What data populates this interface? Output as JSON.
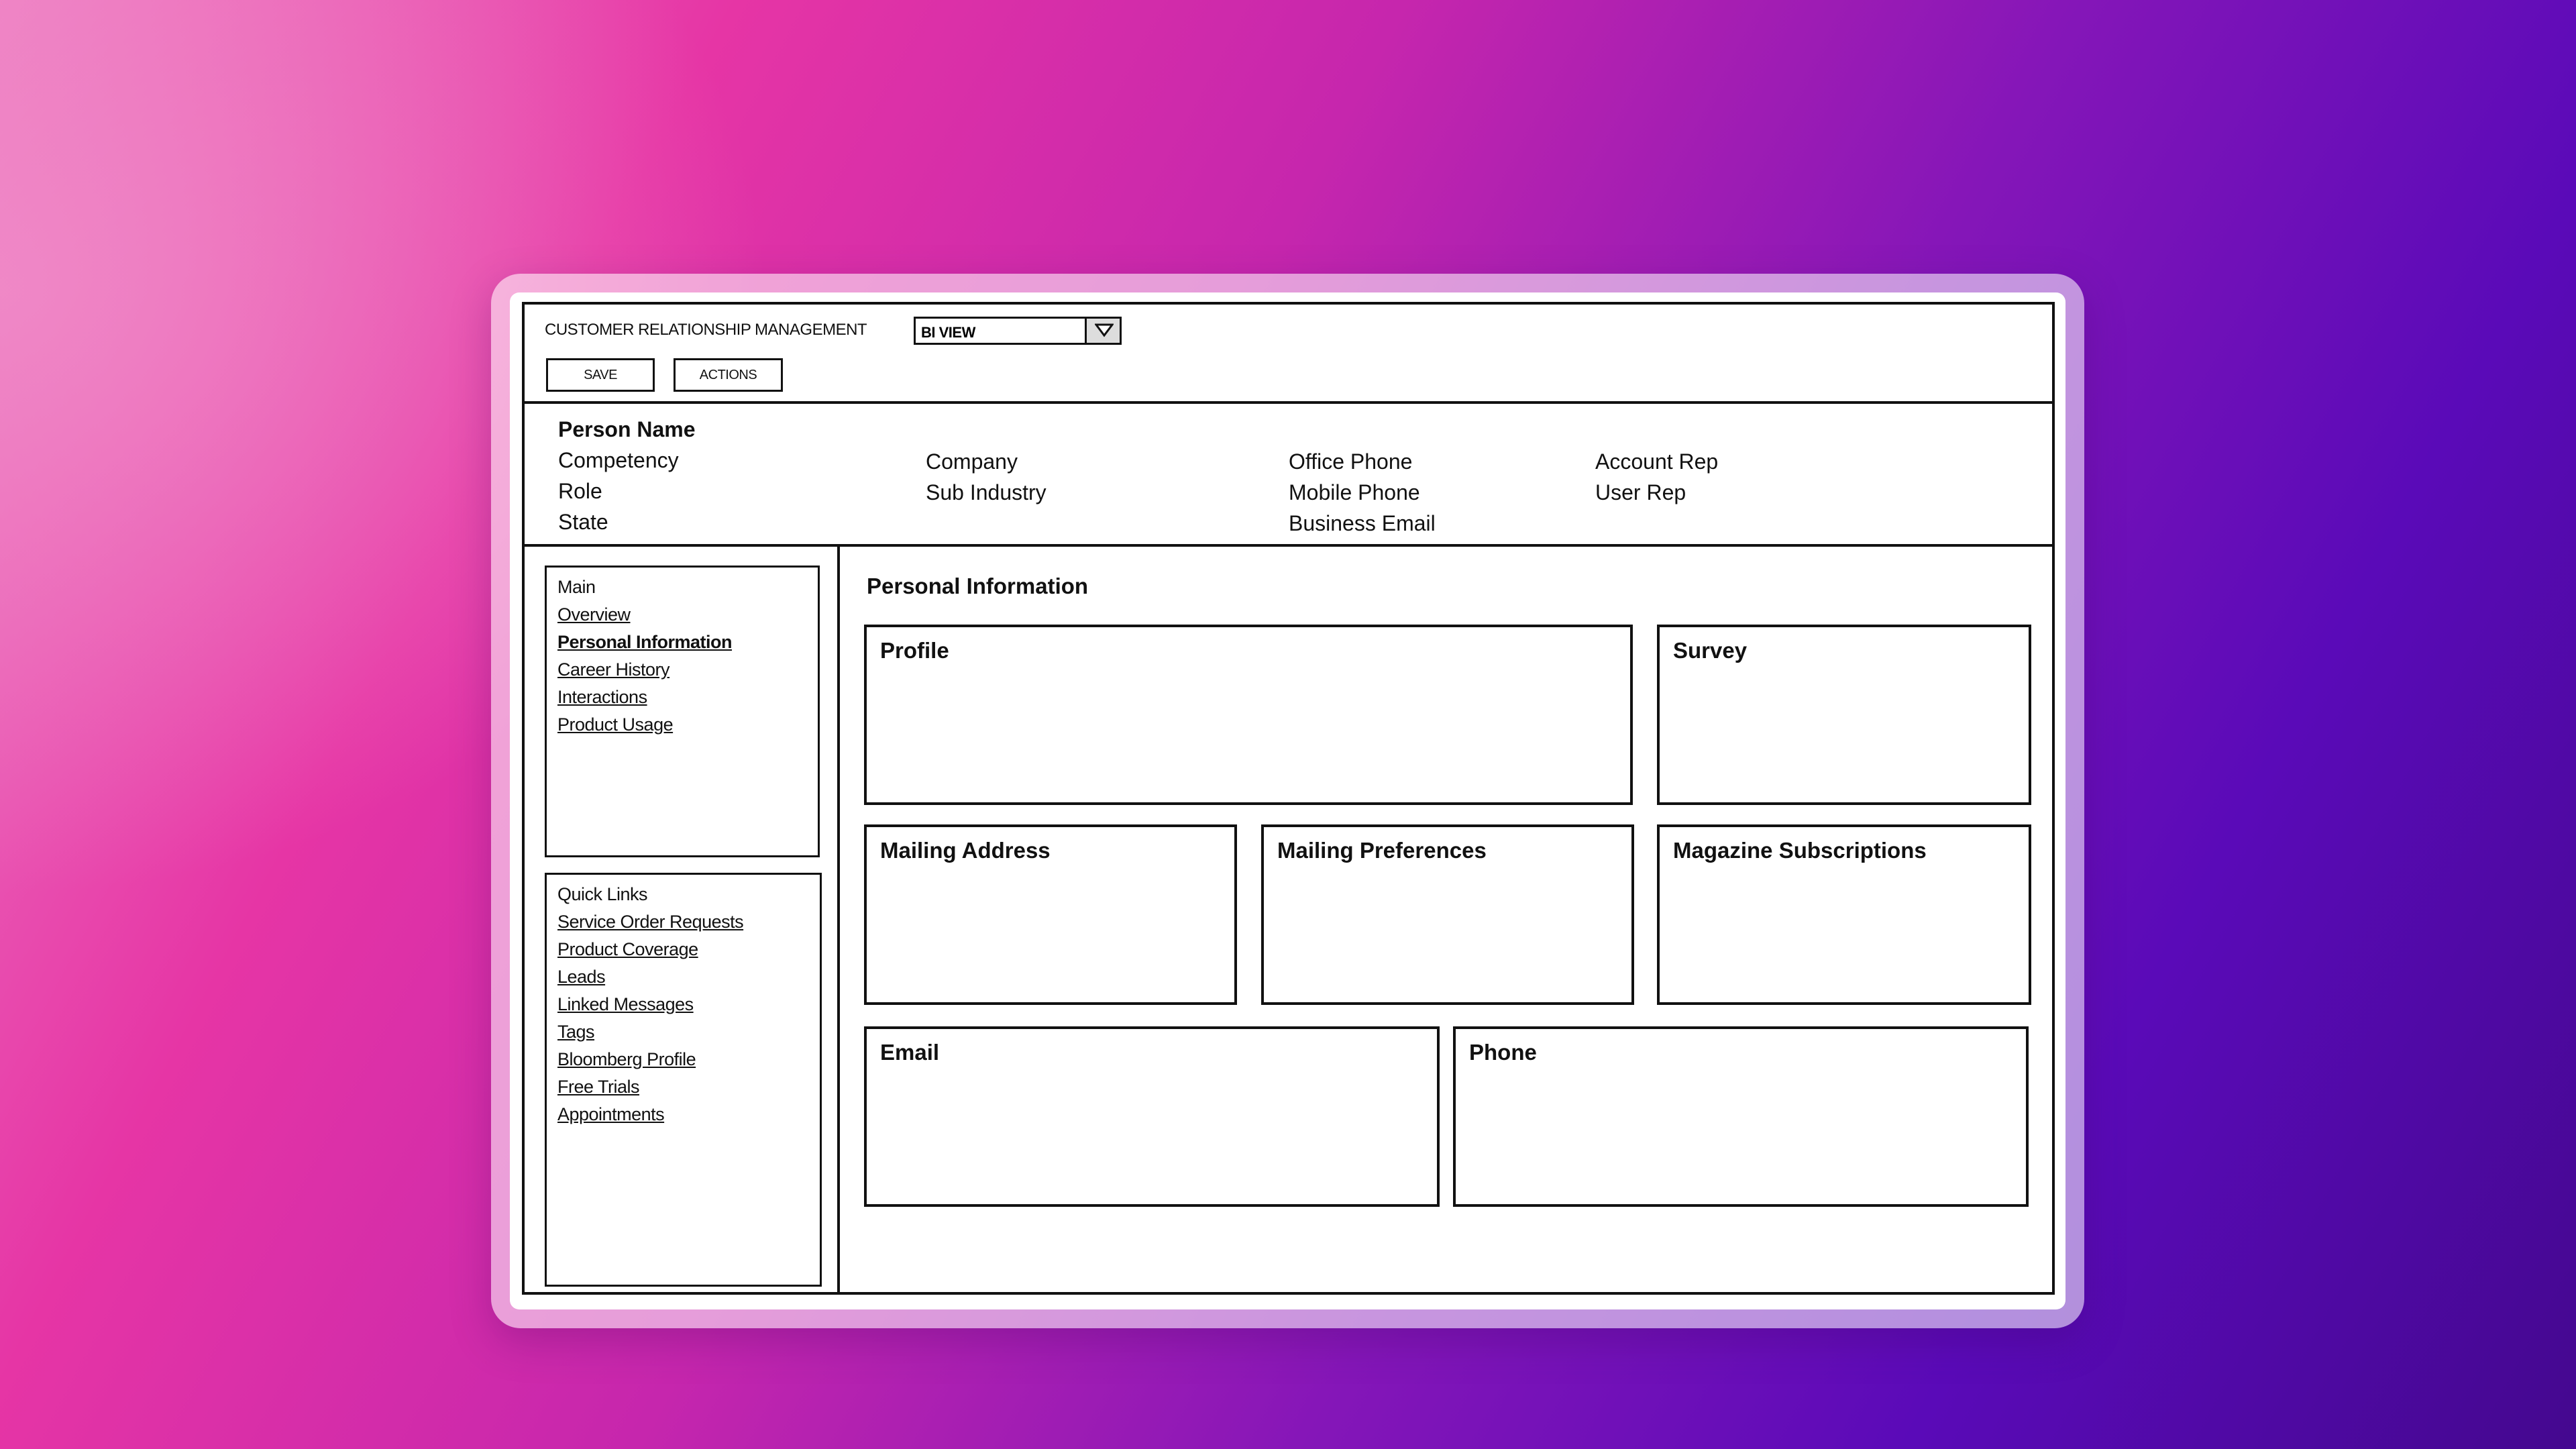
{
  "app": {
    "title": "CUSTOMER RELATIONSHIP MANAGEMENT",
    "view_select": {
      "selected": "BI VIEW"
    }
  },
  "toolbar": {
    "save_label": "SAVE",
    "actions_label": "ACTIONS"
  },
  "person": {
    "name": "Person Name",
    "fields": {
      "competency": "Competency",
      "role": "Role",
      "state": "State",
      "company": "Company",
      "sub_industry": "Sub Industry",
      "office_phone": "Office Phone",
      "mobile_phone": "Mobile Phone",
      "business_email": "Business Email",
      "account_rep": "Account Rep",
      "user_rep": "User Rep"
    }
  },
  "nav_main": {
    "heading": "Main",
    "items": [
      {
        "label": "Overview"
      },
      {
        "label": "Personal Information",
        "active": true
      },
      {
        "label": "Career History"
      },
      {
        "label": "Interactions"
      },
      {
        "label": "Product Usage"
      }
    ]
  },
  "quick_links": {
    "heading": "Quick Links",
    "items": [
      {
        "label": "Service Order Requests"
      },
      {
        "label": "Product Coverage"
      },
      {
        "label": "Leads"
      },
      {
        "label": "Linked Messages"
      },
      {
        "label": "Tags"
      },
      {
        "label": "Bloomberg Profile"
      },
      {
        "label": "Free Trials"
      },
      {
        "label": "Appointments"
      }
    ]
  },
  "content": {
    "section_title": "Personal Information",
    "panels": {
      "profile": "Profile",
      "survey": "Survey",
      "mailing_address": "Mailing Address",
      "mailing_preferences": "Mailing Preferences",
      "magazine_subscriptions": "Magazine Subscriptions",
      "email": "Email",
      "phone": "Phone"
    }
  }
}
